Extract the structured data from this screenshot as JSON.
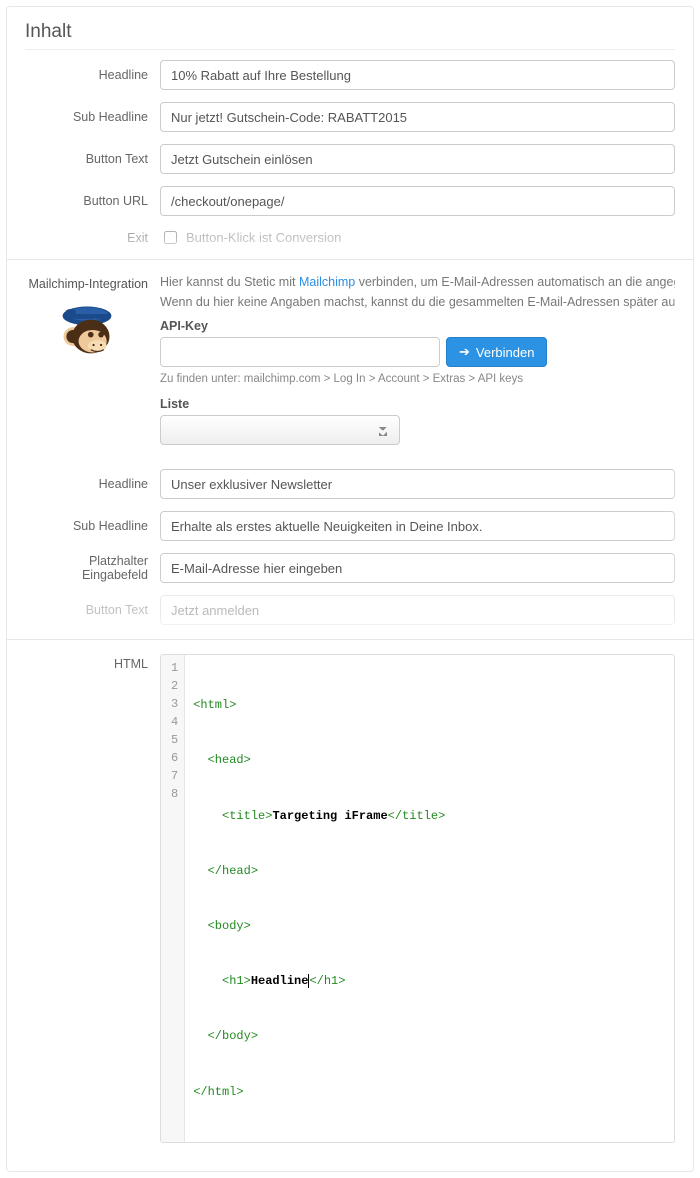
{
  "inhalt": {
    "section_title": "Inhalt",
    "headline_label": "Headline",
    "headline_value": "10% Rabatt auf Ihre Bestellung",
    "sub_headline_label": "Sub Headline",
    "sub_headline_value": "Nur jetzt! Gutschein-Code: RABATT2015",
    "button_text_label": "Button Text",
    "button_text_value": "Jetzt Gutschein einlösen",
    "button_url_label": "Button URL",
    "button_url_value": "/checkout/onepage/",
    "exit_label": "Exit",
    "exit_checkbox_label": "Button-Klick ist Conversion"
  },
  "mailchimp": {
    "section_label": "Mailchimp-Integration",
    "desc_prefix": "Hier kannst du Stetic mit ",
    "desc_link": "Mailchimp",
    "desc_mid": " verbinden, um E-Mail-Adressen automatisch an die angegebene Mailchimp-Liste zu senden. Wenn du hier keine Angaben machst, kannst du die gesammelten E-Mail-Adressen später auf dieser Seite herunterladen.",
    "apikey_label": "API-Key",
    "connect_button": "Verbinden",
    "apikey_help": "Zu finden unter: mailchimp.com > Log In > Account > Extras > API keys",
    "list_label": "Liste",
    "headline_label": "Headline",
    "headline_value": "Unser exklusiver Newsletter",
    "sub_headline_label": "Sub Headline",
    "sub_headline_value": "Erhalte als erstes aktuelle Neuigkeiten in Deine Inbox.",
    "placeholder_label": "Platzhalter Eingabefeld",
    "placeholder_value": "E-Mail-Adresse hier eingeben",
    "button_text_label": "Button Text",
    "button_text_value": "Jetzt anmelden"
  },
  "html": {
    "label": "HTML",
    "code": {
      "l1": {
        "tag": "<html>"
      },
      "l2": {
        "indent": "  ",
        "tag": "<head>"
      },
      "l3": {
        "indent": "    ",
        "tag_open": "<title>",
        "text": "Targeting iFrame",
        "tag_close": "</title>"
      },
      "l4": {
        "indent": "  ",
        "tag": "</head>"
      },
      "l5": {
        "indent": "  ",
        "tag": "<body>"
      },
      "l6": {
        "indent": "    ",
        "tag_open": "<h1>",
        "text": "Headline",
        "tag_close": "</h1>"
      },
      "l7": {
        "indent": "  ",
        "tag": "</body>"
      },
      "l8": {
        "tag": "</html>"
      }
    }
  }
}
